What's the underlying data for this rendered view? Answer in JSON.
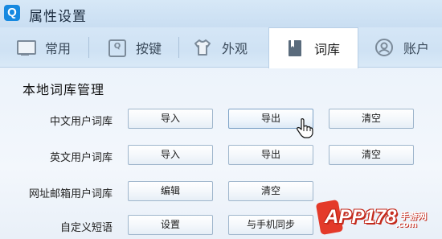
{
  "window": {
    "title": "属性设置",
    "logo_letter": "Q"
  },
  "tabs": [
    {
      "label": "常用",
      "icon": "monitor-icon"
    },
    {
      "label": "按键",
      "icon": "keyboard-icon"
    },
    {
      "label": "外观",
      "icon": "shirt-icon"
    },
    {
      "label": "词库",
      "icon": "book-icon",
      "active": true
    },
    {
      "label": "账户",
      "icon": "user-icon"
    }
  ],
  "section": {
    "title": "本地词库管理"
  },
  "rows": [
    {
      "label": "中文用户词库",
      "buttons": [
        "导入",
        "导出",
        "清空"
      ]
    },
    {
      "label": "英文用户词库",
      "buttons": [
        "导入",
        "导出",
        "清空"
      ]
    },
    {
      "label": "网址邮箱用户词库",
      "buttons": [
        "编辑",
        "清空"
      ]
    },
    {
      "label": "自定义短语",
      "buttons": [
        "设置",
        "与手机同步"
      ]
    }
  ],
  "watermark": {
    "brand": "APP178",
    "sub": "手游网",
    "url": ".com"
  },
  "colors": {
    "accent": "#1689e0",
    "tabbar": "#cfe2f4",
    "button_border": "#9fb6cc",
    "watermark_red": "#e43a2a"
  }
}
